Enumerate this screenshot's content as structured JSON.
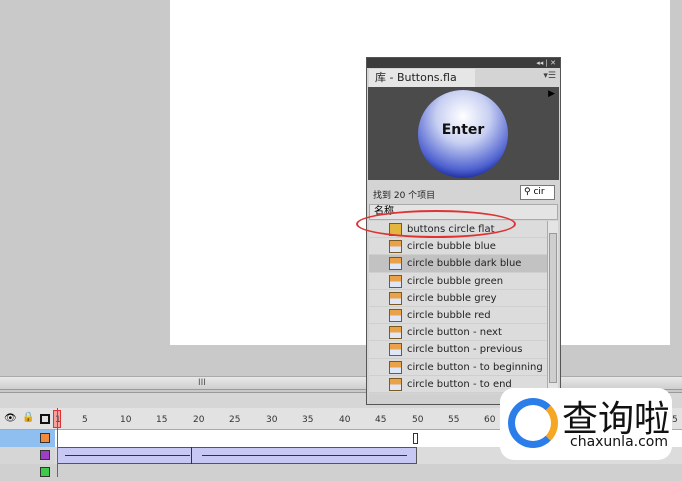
{
  "library": {
    "title": "库 - Buttons.fla",
    "preview_button_label": "Enter",
    "found_text": "找到 20 个项目",
    "search_value": "cir",
    "column_header": "名称",
    "items": [
      {
        "label": "buttons circle flat",
        "icon": "folder-icon",
        "selected": false
      },
      {
        "label": "circle bubble blue",
        "icon": "button-symbol-icon",
        "selected": false
      },
      {
        "label": "circle bubble dark blue",
        "icon": "button-symbol-icon",
        "selected": true
      },
      {
        "label": "circle bubble green",
        "icon": "button-symbol-icon",
        "selected": false
      },
      {
        "label": "circle bubble grey",
        "icon": "button-symbol-icon",
        "selected": false
      },
      {
        "label": "circle bubble red",
        "icon": "button-symbol-icon",
        "selected": false
      },
      {
        "label": "circle button - next",
        "icon": "button-symbol-icon",
        "selected": false
      },
      {
        "label": "circle button - previous",
        "icon": "button-symbol-icon",
        "selected": false
      },
      {
        "label": "circle button - to beginning",
        "icon": "button-symbol-icon",
        "selected": false
      },
      {
        "label": "circle button - to end",
        "icon": "button-symbol-icon",
        "selected": false
      }
    ]
  },
  "timeline": {
    "frame_labels": [
      "1",
      "5",
      "10",
      "15",
      "20",
      "25",
      "30",
      "35",
      "40",
      "45",
      "50",
      "55",
      "60",
      "5"
    ],
    "current_frame": "1",
    "layer_colors": [
      "#f08a3c",
      "#9b3fc7",
      "#3ec94a"
    ]
  },
  "watermark": {
    "text": "查询啦",
    "url": "chaxunla.com"
  }
}
